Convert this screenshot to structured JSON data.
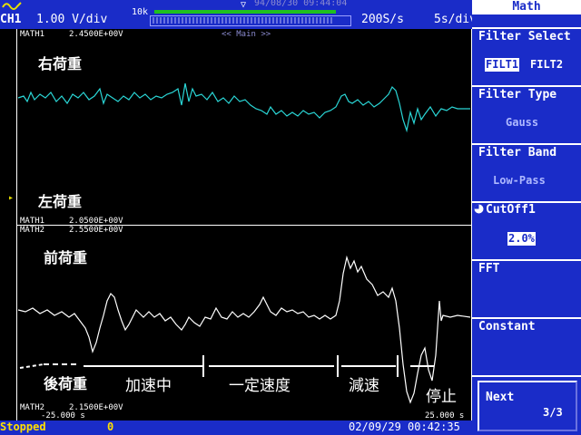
{
  "header": {
    "channel": "CH1",
    "volts_div": "1.00 V/div",
    "record_length_label": "10k",
    "trigger_datetime": "94/08/30 09:44:04",
    "sample_rate": "200S/s",
    "time_div": "5s/div"
  },
  "traces": {
    "math1_top_label": "MATH1",
    "math1_top_value": "2.4500E+00V",
    "view_mode": "<< Main >>",
    "math1_bottom_label": "MATH1",
    "math1_bottom_value": "2.0500E+00V",
    "math2_top_label": "MATH2",
    "math2_top_value": "2.5500E+00V",
    "math2_bottom_label": "MATH2",
    "math2_bottom_value": "2.1500E+00V",
    "time_left": "-25.000 s",
    "time_right": "25.000 s"
  },
  "annotations": {
    "right_load": "右荷重",
    "left_load": "左荷重",
    "front_load": "前荷重",
    "rear_load": "後荷重",
    "accelerating": "加速中",
    "constant_speed": "一定速度",
    "decelerating": "減速",
    "stopped": "停止"
  },
  "status": {
    "state": "Stopped",
    "count": "0",
    "datetime": "02/09/29 00:42:35"
  },
  "menu": {
    "title": "Math",
    "filter_select_label": "Filter Select",
    "filter_options": [
      "FILT1",
      "FILT2"
    ],
    "filter_selected": "FILT1",
    "filter_type_label": "Filter Type",
    "filter_type_value": "Gauss",
    "filter_band_label": "Filter Band",
    "filter_band_value": "Low-Pass",
    "cutoff_label": "CutOff1",
    "cutoff_value": "2.0%",
    "fft_label": "FFT",
    "constant_label": "Constant",
    "next_label": "Next",
    "page": "3/3"
  },
  "colors": {
    "panel_blue": "#1a2cc8",
    "trace_cyan": "#2ad6d6",
    "trace_white": "#ffffff",
    "status_yellow": "#ffe000",
    "timebar_green": "#1fc01f"
  },
  "icons": [
    "scope-logo-icon",
    "trigger-marker-icon",
    "level-marker-icon",
    "knob-icon"
  ]
}
